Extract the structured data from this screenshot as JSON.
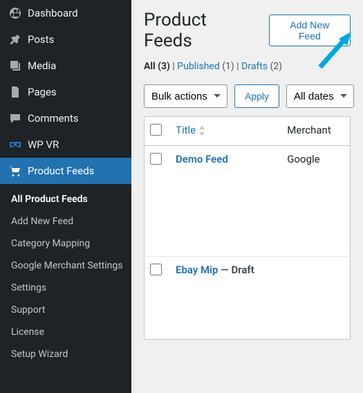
{
  "sidebar": {
    "items": [
      {
        "label": "Dashboard",
        "icon": "dashboard"
      },
      {
        "label": "Posts",
        "icon": "pin"
      },
      {
        "label": "Media",
        "icon": "media"
      },
      {
        "label": "Pages",
        "icon": "pages"
      },
      {
        "label": "Comments",
        "icon": "comments"
      },
      {
        "label": "WP VR",
        "icon": "wpvr"
      },
      {
        "label": "Product Feeds",
        "icon": "cart"
      }
    ],
    "active_index": 6,
    "submenu": [
      "All Product Feeds",
      "Add New Feed",
      "Category Mapping",
      "Google Merchant Settings",
      "Settings",
      "Support",
      "License",
      "Setup Wizard"
    ],
    "submenu_current_index": 0
  },
  "header": {
    "title": "Product Feeds",
    "add_new": "Add New Feed"
  },
  "filters": {
    "all_label": "All",
    "all_count": "(3)",
    "published_label": "Published",
    "published_count": "(1)",
    "drafts_label": "Drafts",
    "drafts_count": "(2)",
    "sep": "  |  "
  },
  "controls": {
    "bulk_selected": "Bulk actions",
    "apply": "Apply",
    "date_selected": "All dates"
  },
  "table": {
    "col_title": "Title",
    "col_merchant": "Merchant",
    "rows": [
      {
        "title": "Demo Feed",
        "merchant": "Google",
        "status": ""
      },
      {
        "title": "Ebay Mip",
        "merchant": "",
        "status": "Draft"
      }
    ],
    "status_sep": " — "
  }
}
